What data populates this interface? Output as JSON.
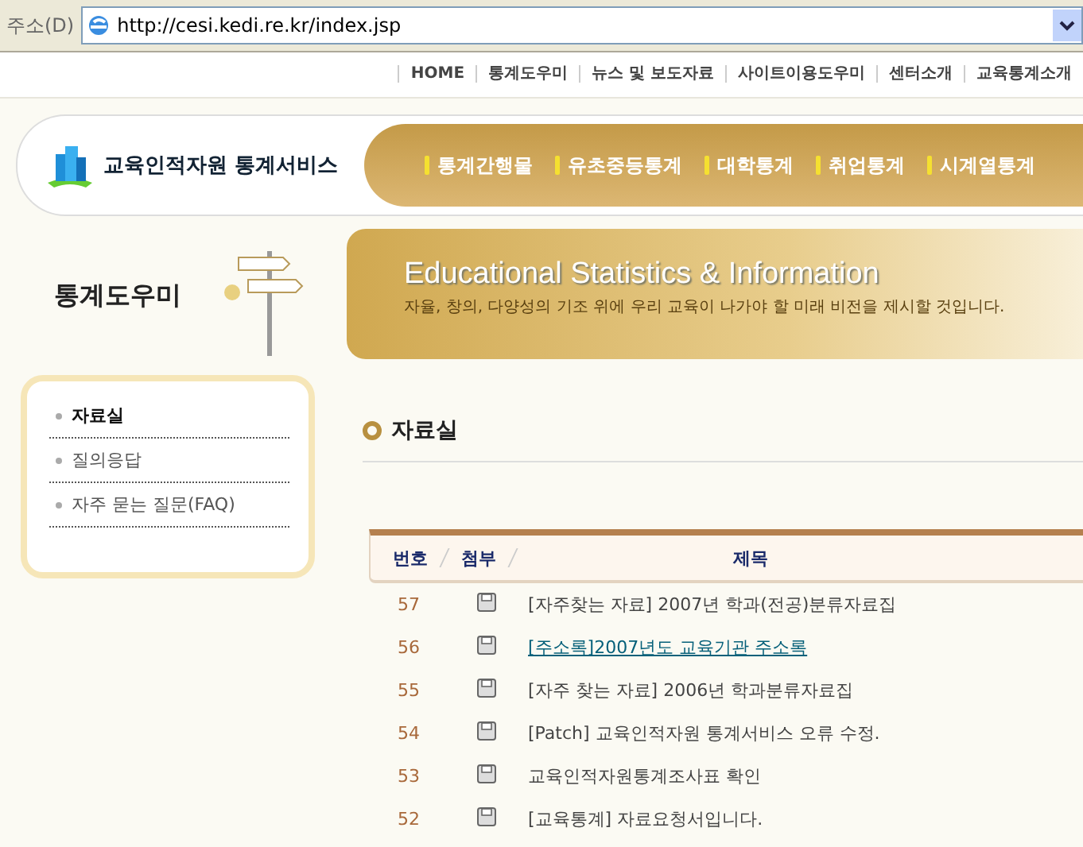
{
  "address_bar": {
    "label": "주소(D)",
    "url": "http://cesi.kedi.re.kr/index.jsp"
  },
  "top_links": [
    "HOME",
    "통계도우미",
    "뉴스 및 보도자료",
    "사이트이용도우미",
    "센터소개",
    "교육통계소개"
  ],
  "logo": {
    "text": "교육인적자원 통계서비스"
  },
  "main_nav": [
    "통계간행물",
    "유초중등통계",
    "대학통계",
    "취업통계",
    "시계열통계"
  ],
  "sidebar": {
    "title": "통계도우미",
    "items": [
      {
        "label": "자료실",
        "selected": true
      },
      {
        "label": "질의응답",
        "selected": false
      },
      {
        "label": "자주 묻는 질문(FAQ)",
        "selected": false
      }
    ]
  },
  "banner": {
    "title": "Educational Statistics & Information",
    "subtitle": "자율, 창의, 다양성의 기조 위에 우리 교육이 나가야 할 미래 비전을 제시할 것입니다."
  },
  "section_title": "자료실",
  "table": {
    "columns": [
      "번호",
      "첨부",
      "제목"
    ],
    "rows": [
      {
        "number": "57",
        "title": "[자주찾는 자료] 2007년 학과(전공)분류자료집",
        "hovered": false
      },
      {
        "number": "56",
        "title": "[주소록]2007년도 교육기관 주소록",
        "hovered": true
      },
      {
        "number": "55",
        "title": "[자주 찾는 자료] 2006년 학과분류자료집",
        "hovered": false
      },
      {
        "number": "54",
        "title": "[Patch] 교육인적자원 통계서비스 오류 수정.",
        "hovered": false
      },
      {
        "number": "53",
        "title": "교육인적자원통계조사표 확인",
        "hovered": false
      },
      {
        "number": "52",
        "title": "[교육통계] 자료요청서입니다.",
        "hovered": false
      }
    ]
  }
}
